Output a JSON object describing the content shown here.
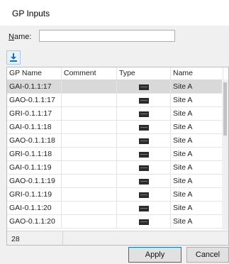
{
  "window": {
    "title": "GP Inputs"
  },
  "filter": {
    "name_label_accel": "N",
    "name_label_rest": "ame:",
    "name_value": ""
  },
  "toolbar": {
    "export_icon": "download-icon"
  },
  "grid": {
    "columns": [
      "GP Name",
      "Comment",
      "Type",
      "Name"
    ],
    "rows": [
      {
        "gp_name": "GAI-0.1.1:17",
        "comment": "",
        "type_icon": "device-icon",
        "name": "Site A"
      },
      {
        "gp_name": "GAO-0.1.1:17",
        "comment": "",
        "type_icon": "device-icon",
        "name": "Site A"
      },
      {
        "gp_name": "GRI-0.1.1:17",
        "comment": "",
        "type_icon": "device-icon",
        "name": "Site A"
      },
      {
        "gp_name": "GAI-0.1.1:18",
        "comment": "",
        "type_icon": "device-icon",
        "name": "Site A"
      },
      {
        "gp_name": "GAO-0.1.1:18",
        "comment": "",
        "type_icon": "device-icon",
        "name": "Site A"
      },
      {
        "gp_name": "GRI-0.1.1:18",
        "comment": "",
        "type_icon": "device-icon",
        "name": "Site A"
      },
      {
        "gp_name": "GAI-0.1.1:19",
        "comment": "",
        "type_icon": "device-icon",
        "name": "Site A"
      },
      {
        "gp_name": "GAO-0.1.1:19",
        "comment": "",
        "type_icon": "device-icon",
        "name": "Site A"
      },
      {
        "gp_name": "GRI-0.1.1:19",
        "comment": "",
        "type_icon": "device-icon",
        "name": "Site A"
      },
      {
        "gp_name": "GAI-0.1.1:20",
        "comment": "",
        "type_icon": "device-icon",
        "name": "Site A"
      },
      {
        "gp_name": "GAO-0.1.1:20",
        "comment": "",
        "type_icon": "device-icon",
        "name": "Site A"
      }
    ],
    "row_count": "28"
  },
  "buttons": {
    "apply": "Apply",
    "cancel": "Cancel"
  },
  "colors": {
    "accent": "#0078d7",
    "selected_row": "#d9d9d9",
    "export_bg": "#e5f1fb",
    "export_arrow": "#1e6ebf"
  }
}
